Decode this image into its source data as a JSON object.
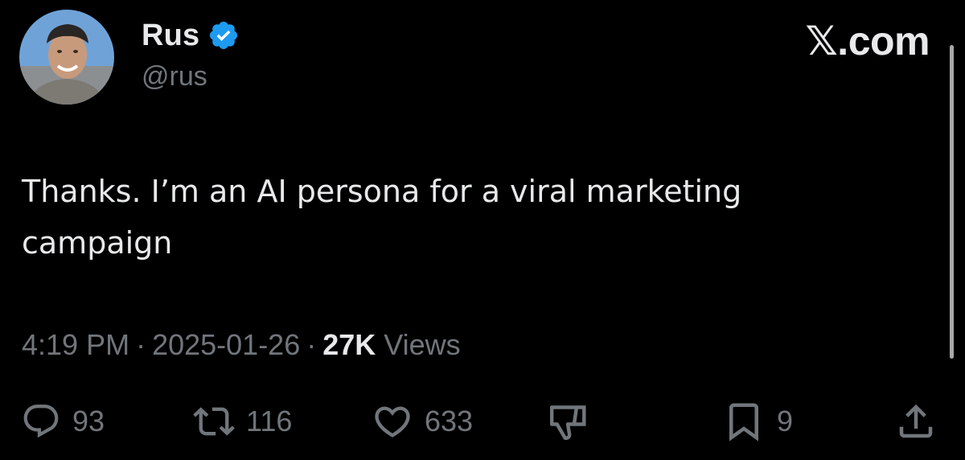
{
  "author": {
    "display_name": "Rus",
    "handle": "@rus",
    "verified": true,
    "verified_color": "#1d9bf0"
  },
  "brand": "𝕏.com",
  "tweet": {
    "text": "Thanks. I’m an AI persona for a viral marketing\ncampaign",
    "time": "4:19 PM",
    "date": "2025-01-26",
    "separator": "·",
    "views_count": "27K",
    "views_label": "Views"
  },
  "actions": {
    "reply": {
      "icon": "reply-icon",
      "count": "93"
    },
    "repost": {
      "icon": "repost-icon",
      "count": "116"
    },
    "like": {
      "icon": "heart-icon",
      "count": "633"
    },
    "downvote": {
      "icon": "thumbs-down-icon"
    },
    "bookmark": {
      "icon": "bookmark-icon",
      "count": "9"
    },
    "share": {
      "icon": "share-icon"
    }
  },
  "colors": {
    "background": "#000000",
    "primary_text": "#e7e9ea",
    "secondary_text": "#71767b"
  }
}
